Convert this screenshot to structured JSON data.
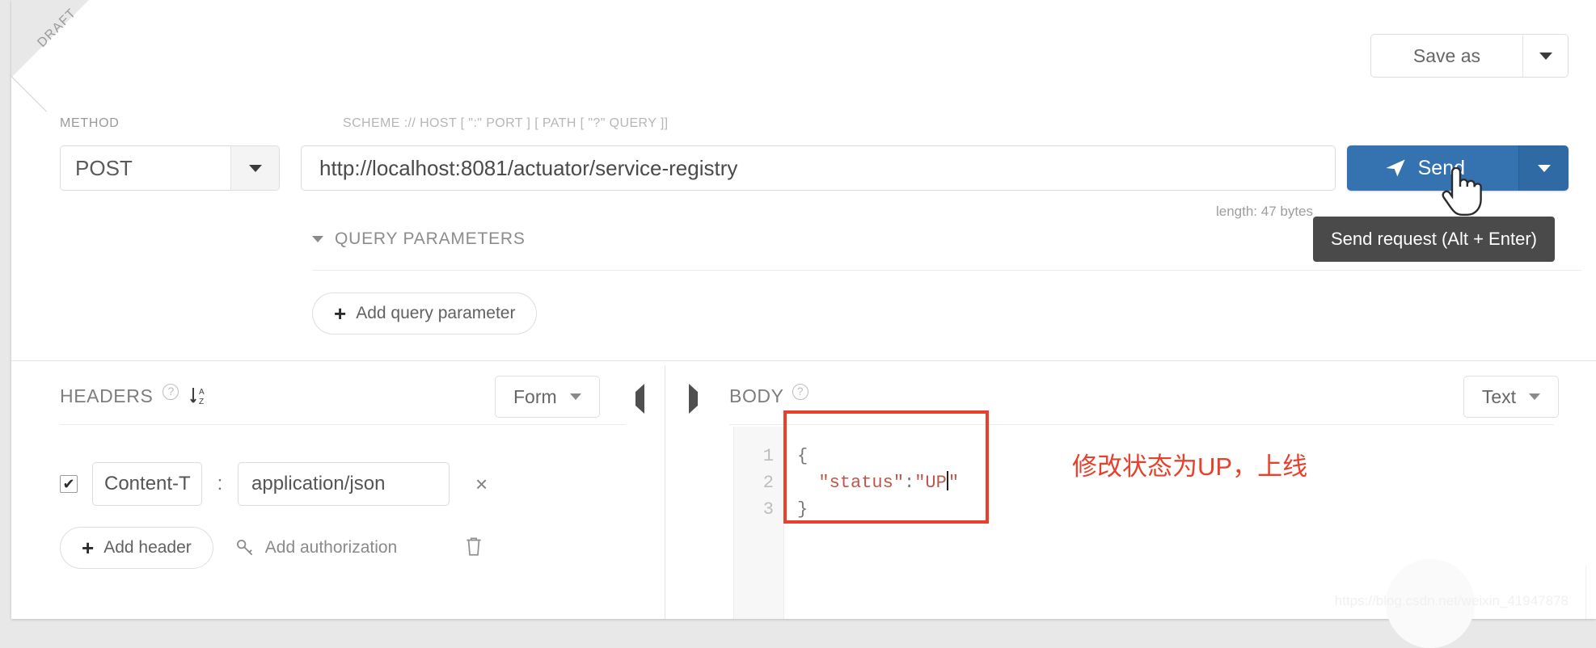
{
  "ribbon": {
    "label": "DRAFT"
  },
  "toolbar": {
    "save_as_label": "Save as",
    "save_as_caret_icon": "chevron-down-icon"
  },
  "request": {
    "method_label": "METHOD",
    "method_value": "POST",
    "url_label": "SCHEME :// HOST [ \":\" PORT ] [ PATH [ \"?\" QUERY ]]",
    "url_value": "http://localhost:8081/actuator/service-registry",
    "send_label": "Send",
    "send_icon": "paper-plane-icon",
    "send_caret_icon": "chevron-down-icon",
    "length_text": "length: 47 bytes",
    "tooltip": "Send request (Alt + Enter)"
  },
  "query_parameters": {
    "title": "QUERY PARAMETERS",
    "toggle_icon": "caret-down-icon",
    "add_label": "Add query parameter",
    "add_icon": "plus-icon"
  },
  "headers": {
    "title": "HEADERS",
    "help_icon": "question-mark-icon",
    "sort_icon": "sort-alpha-asc-icon",
    "view_mode": "Form",
    "view_mode_caret_icon": "chevron-down-icon",
    "collapse_left_icon": "caret-left-icon",
    "collapse_right_icon": "caret-right-icon",
    "rows": [
      {
        "enabled": true,
        "checkbox_mark": "✔",
        "key": "Content-T",
        "separator": ":",
        "value": "application/json",
        "remove_icon": "close-icon",
        "remove_label": "×"
      }
    ],
    "add_header_label": "Add header",
    "add_header_icon": "plus-icon",
    "add_authorization_label": "Add authorization",
    "add_authorization_icon": "key-icon",
    "delete_icon": "trash-icon"
  },
  "body": {
    "title": "BODY",
    "help_icon": "question-mark-icon",
    "format": "Text",
    "format_caret_icon": "chevron-down-icon",
    "line_numbers": [
      "1",
      "2",
      "3"
    ],
    "lines": [
      "{",
      "  \"status\":\"UP\"",
      "}"
    ],
    "code_open_brace": "{",
    "code_key": "\"status\"",
    "code_colon": ":",
    "code_value_open": "\"UP",
    "code_value_close": "\"",
    "code_close_brace": "}"
  },
  "annotation": {
    "text": "修改状态为UP，上线",
    "color": "#e8402a"
  },
  "watermark": {
    "text": "https://blog.csdn.net/weixin_41947878"
  },
  "colors": {
    "send_blue": "#3572b0",
    "annotation_red": "#e8402a",
    "tooltip_bg": "#4a4a4a",
    "page_bg": "#e8e8e8"
  }
}
